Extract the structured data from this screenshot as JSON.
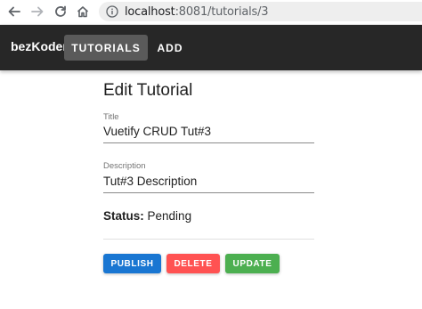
{
  "browser": {
    "url_host": "localhost",
    "url_path": ":8081/tutorials/3"
  },
  "app_bar": {
    "brand": "bezKoder",
    "tabs": [
      {
        "label": "TUTORIALS",
        "active": true
      },
      {
        "label": "ADD",
        "active": false
      }
    ]
  },
  "form": {
    "heading": "Edit Tutorial",
    "title_field": {
      "label": "Title",
      "value": "Vuetify CRUD Tut#3"
    },
    "description_field": {
      "label": "Description",
      "value": "Tut#3 Description"
    },
    "status": {
      "label": "Status:",
      "value": "Pending"
    },
    "buttons": {
      "publish": "PUBLISH",
      "delete": "DELETE",
      "update": "UPDATE"
    }
  },
  "colors": {
    "app_bar": "#272727",
    "publish": "#1976d2",
    "delete": "#ff5252",
    "update": "#4caf50"
  }
}
